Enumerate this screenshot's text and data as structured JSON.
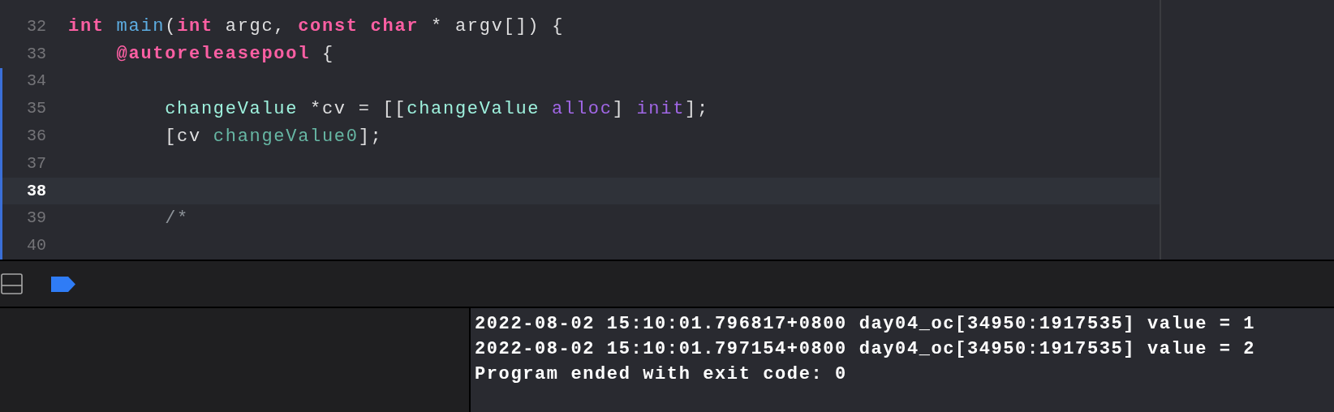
{
  "editor": {
    "lines": [
      {
        "number": "32",
        "current": false,
        "changed": false,
        "tokens": [
          {
            "text": "int",
            "kind": "keyword"
          },
          {
            "text": " main",
            "kind": "function"
          },
          {
            "text": "(",
            "kind": "plain"
          },
          {
            "text": "int",
            "kind": "keyword"
          },
          {
            "text": " argc, ",
            "kind": "plain"
          },
          {
            "text": "const",
            "kind": "keyword"
          },
          {
            "text": " char",
            "kind": "keyword"
          },
          {
            "text": " * argv[]) {",
            "kind": "plain"
          }
        ]
      },
      {
        "number": "33",
        "current": false,
        "changed": false,
        "tokens": [
          {
            "text": "    @autoreleasepool",
            "kind": "keyword"
          },
          {
            "text": " {",
            "kind": "plain"
          }
        ]
      },
      {
        "number": "34",
        "current": false,
        "changed": true
      },
      {
        "number": "35",
        "current": false,
        "changed": true,
        "tokens": [
          {
            "text": "        changeValue",
            "kind": "type"
          },
          {
            "text": " *cv = [[",
            "kind": "plain"
          },
          {
            "text": "changeValue",
            "kind": "type"
          },
          {
            "text": " alloc",
            "kind": "method"
          },
          {
            "text": "] ",
            "kind": "plain"
          },
          {
            "text": "init",
            "kind": "method"
          },
          {
            "text": "];",
            "kind": "plain"
          }
        ]
      },
      {
        "number": "36",
        "current": false,
        "changed": true,
        "tokens": [
          {
            "text": "        [cv ",
            "kind": "plain"
          },
          {
            "text": "changeValue0",
            "kind": "project_method"
          },
          {
            "text": "];",
            "kind": "plain"
          }
        ]
      },
      {
        "number": "37",
        "current": false,
        "changed": true
      },
      {
        "number": "38",
        "current": true,
        "changed": true
      },
      {
        "number": "39",
        "current": false,
        "changed": true,
        "tokens": [
          {
            "text": "        /*",
            "kind": "comment"
          }
        ]
      },
      {
        "number": "40",
        "current": false,
        "changed": true
      }
    ]
  },
  "debug_bar": {
    "breakpoints_active": true
  },
  "console": {
    "lines": [
      "2022-08-02 15:10:01.796817+0800 day04_oc[34950:1917535] value = 1",
      "2022-08-02 15:10:01.797154+0800 day04_oc[34950:1917535] value = 2",
      "Program ended with exit code: 0"
    ]
  }
}
